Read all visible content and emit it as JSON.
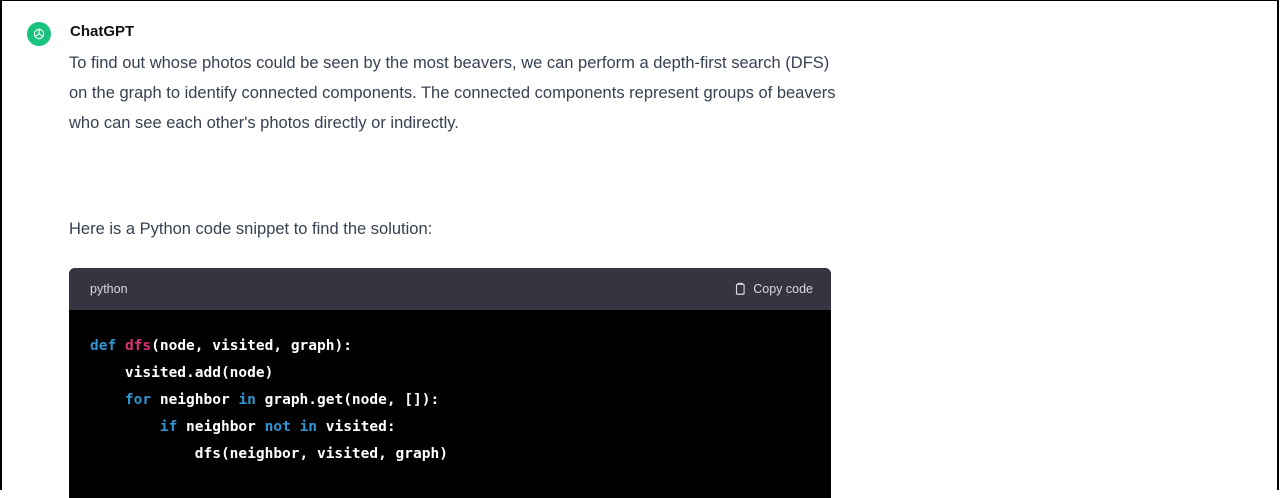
{
  "message": {
    "author": "ChatGPT",
    "paragraphs": [
      "To find out whose photos could be seen by the most beavers, we can perform a depth-first search (DFS) on the graph to identify connected components. The connected components represent groups of beavers who can see each other's photos directly or indirectly.",
      "Here is a Python code snippet to find the solution:"
    ]
  },
  "code_block": {
    "language": "python",
    "copy_label": "Copy code",
    "lines": [
      [
        {
          "t": "def",
          "c": "kw"
        },
        {
          "t": " "
        },
        {
          "t": "dfs",
          "c": "fn"
        },
        {
          "t": "(node, visited, graph):"
        }
      ],
      [
        {
          "t": "    visited.add(node)"
        }
      ],
      [
        {
          "t": "    "
        },
        {
          "t": "for",
          "c": "kw"
        },
        {
          "t": " neighbor "
        },
        {
          "t": "in",
          "c": "kw"
        },
        {
          "t": " graph.get(node, []):"
        }
      ],
      [
        {
          "t": "        "
        },
        {
          "t": "if",
          "c": "kw"
        },
        {
          "t": " neighbor "
        },
        {
          "t": "not",
          "c": "kw"
        },
        {
          "t": " "
        },
        {
          "t": "in",
          "c": "kw"
        },
        {
          "t": " visited:"
        }
      ],
      [
        {
          "t": "            dfs(neighbor, visited, graph)"
        }
      ]
    ]
  },
  "colors": {
    "avatar_bg": "#19c37d",
    "code_bg": "#000000",
    "code_header_bg": "#343541",
    "keyword": "#2e95d3",
    "function_name": "#df3079"
  },
  "icons": {
    "avatar": "openai-logo-icon",
    "copy": "clipboard-icon"
  }
}
